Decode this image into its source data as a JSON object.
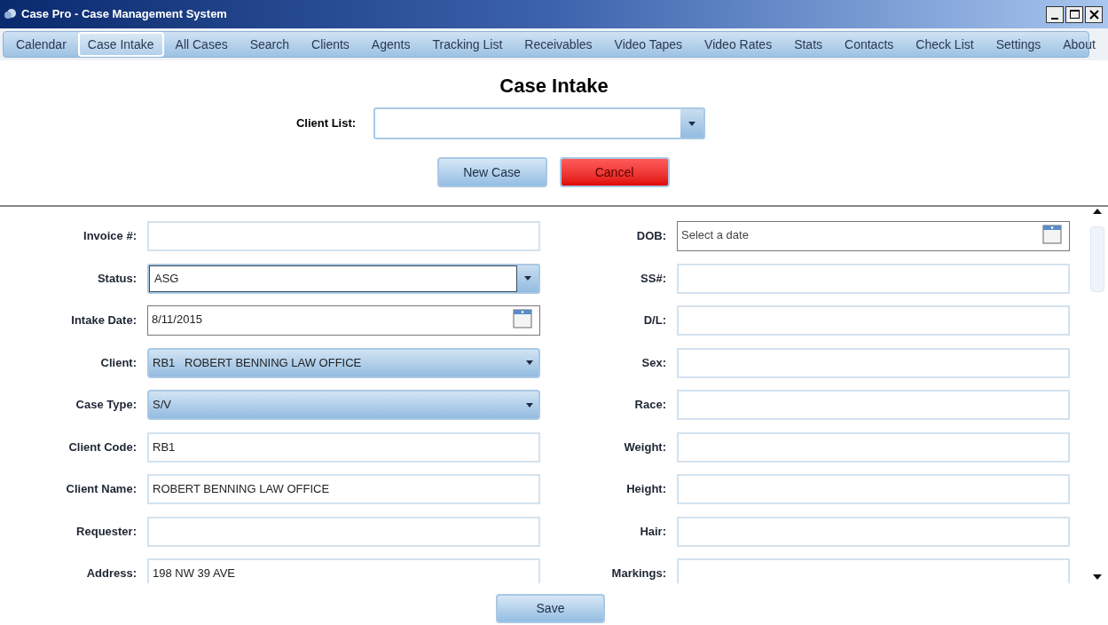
{
  "window": {
    "title": "Case Pro - Case Management System"
  },
  "tabs": [
    {
      "label": "Calendar",
      "selected": false
    },
    {
      "label": "Case Intake",
      "selected": true
    },
    {
      "label": "All Cases",
      "selected": false
    },
    {
      "label": "Search",
      "selected": false
    },
    {
      "label": "Clients",
      "selected": false
    },
    {
      "label": "Agents",
      "selected": false
    },
    {
      "label": "Tracking List",
      "selected": false
    },
    {
      "label": "Receivables",
      "selected": false
    },
    {
      "label": "Video Tapes",
      "selected": false
    },
    {
      "label": "Video Rates",
      "selected": false
    },
    {
      "label": "Stats",
      "selected": false
    },
    {
      "label": "Contacts",
      "selected": false
    },
    {
      "label": "Check List",
      "selected": false
    },
    {
      "label": "Settings",
      "selected": false
    },
    {
      "label": "About",
      "selected": false
    }
  ],
  "heading": "Case Intake",
  "client_list": {
    "label": "Client List:"
  },
  "top_buttons": [
    {
      "label": "New Case",
      "kind": "normal"
    },
    {
      "label": "Cancel",
      "kind": "danger"
    }
  ],
  "left_fields": [
    {
      "label": "Invoice #:",
      "kind": "text"
    },
    {
      "label": "Status:",
      "kind": "combo",
      "value": "ASG"
    },
    {
      "label": "Intake Date:",
      "kind": "date",
      "value": "8/11/2015"
    },
    {
      "label": "Client:",
      "kind": "select",
      "value": "RB1   ROBERT BENNING LAW OFFICE"
    },
    {
      "label": "Case Type:",
      "kind": "select",
      "value": "S/V"
    },
    {
      "label": "Client Code:",
      "kind": "text",
      "value": "RB1"
    },
    {
      "label": "Client Name:",
      "kind": "text",
      "value": "ROBERT BENNING LAW OFFICE"
    },
    {
      "label": "Requester:",
      "kind": "text"
    },
    {
      "label": "Address:",
      "kind": "text",
      "value": "198 NW 39 AVE"
    }
  ],
  "right_fields": [
    {
      "label": "DOB:",
      "kind": "date",
      "placeholder": "Select a date"
    },
    {
      "label": "SS#:",
      "kind": "text"
    },
    {
      "label": "D/L:",
      "kind": "text"
    },
    {
      "label": "Sex:",
      "kind": "text"
    },
    {
      "label": "Race:",
      "kind": "text"
    },
    {
      "label": "Weight:",
      "kind": "text"
    },
    {
      "label": "Height:",
      "kind": "text"
    },
    {
      "label": "Hair:",
      "kind": "text"
    },
    {
      "label": "Markings:",
      "kind": "text"
    }
  ],
  "save_button": "Save"
}
